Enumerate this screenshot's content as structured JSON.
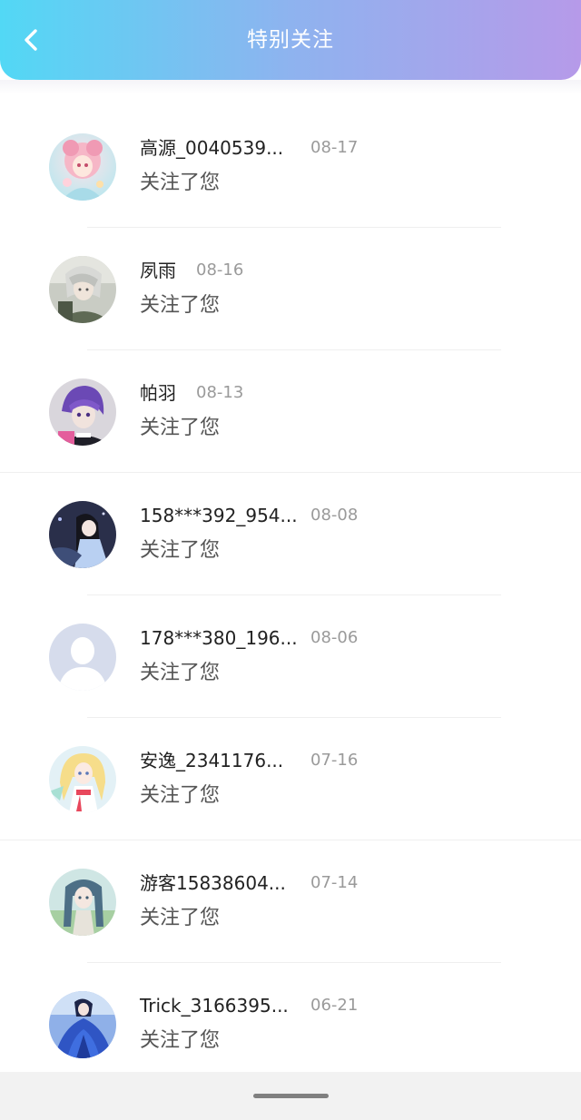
{
  "header": {
    "title": "特别关注",
    "back_icon": "chevron-left-icon"
  },
  "list": [
    {
      "name": "高源_0040539...",
      "date": "08-17",
      "action": "关注了您",
      "avatar": "anime-pink-girl"
    },
    {
      "name": "夙雨",
      "date": "08-16",
      "action": "关注了您",
      "avatar": "anime-silver-hair"
    },
    {
      "name": "帕羽",
      "date": "08-13",
      "action": "关注了您",
      "avatar": "anime-purple-hair"
    },
    {
      "name": "158***392_954...",
      "date": "08-08",
      "action": "关注了您",
      "avatar": "anime-dark-scene"
    },
    {
      "name": "178***380_196...",
      "date": "08-06",
      "action": "关注了您",
      "avatar": "default-user"
    },
    {
      "name": "安逸_2341176...",
      "date": "07-16",
      "action": "关注了您",
      "avatar": "anime-blonde-girl"
    },
    {
      "name": "游客15838604...",
      "date": "07-14",
      "action": "关注了您",
      "avatar": "anime-twin-tails"
    },
    {
      "name": "Trick_3166395...",
      "date": "06-21",
      "action": "关注了您",
      "avatar": "anime-blue-dress"
    }
  ],
  "colors": {
    "header_gradient": [
      "#52d8f5",
      "#8eb3ef",
      "#b69ae9"
    ],
    "name_text": "#222222",
    "date_text": "#9a9a9a",
    "action_text": "#555555"
  }
}
